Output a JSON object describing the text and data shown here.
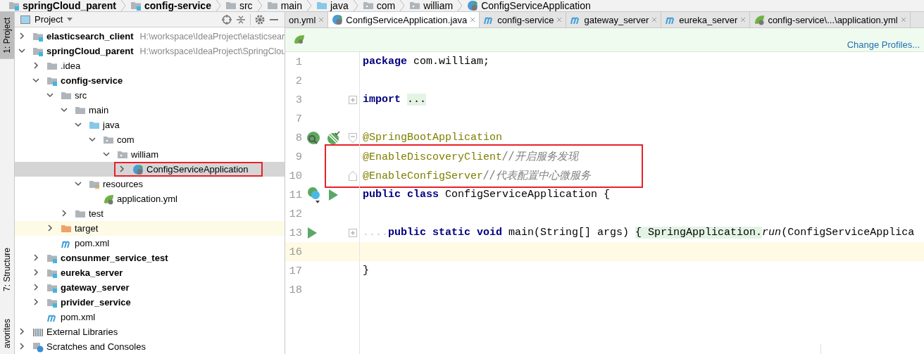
{
  "breadcrumbs": [
    {
      "label": "springCloud_parent",
      "kind": "module"
    },
    {
      "label": "config-service",
      "kind": "module"
    },
    {
      "label": "src",
      "kind": "folder"
    },
    {
      "label": "main",
      "kind": "folder"
    },
    {
      "label": "java",
      "kind": "source"
    },
    {
      "label": "com",
      "kind": "package"
    },
    {
      "label": "william",
      "kind": "package"
    },
    {
      "label": "ConfigServiceApplication",
      "kind": "class"
    }
  ],
  "tool_strip": [
    {
      "label": "1: Project",
      "selected": true
    },
    {
      "label": "7: Structure",
      "selected": false
    },
    {
      "label": "avorites",
      "selected": false
    }
  ],
  "project_panel": {
    "title": "Project",
    "tree": [
      {
        "label": "elasticsearch_client",
        "path": "H:\\workspace\\IdeaProject\\elasticsear",
        "kind": "module",
        "expanded": false,
        "selected": false
      },
      {
        "label": "springCloud_parent",
        "path": "H:\\workspace\\IdeaProject\\SpringClou",
        "kind": "module",
        "expanded": true,
        "selected": false,
        "children": [
          {
            "label": ".idea",
            "kind": "folder",
            "expanded": false,
            "selected": false
          },
          {
            "label": "config-service",
            "kind": "module",
            "expanded": true,
            "selected": false,
            "children": [
              {
                "label": "src",
                "kind": "folder",
                "expanded": true,
                "selected": false,
                "children": [
                  {
                    "label": "main",
                    "kind": "folder",
                    "expanded": true,
                    "selected": false,
                    "children": [
                      {
                        "label": "java",
                        "kind": "source",
                        "expanded": true,
                        "selected": false,
                        "children": [
                          {
                            "label": "com",
                            "kind": "package",
                            "expanded": true,
                            "selected": false,
                            "children": [
                              {
                                "label": "william",
                                "kind": "package",
                                "expanded": true,
                                "selected": false,
                                "children": [
                                  {
                                    "label": "ConfigServiceApplication",
                                    "kind": "class",
                                    "expanded": false,
                                    "selected": true,
                                    "boxed": true
                                  }
                                ]
                              }
                            ]
                          }
                        ]
                      },
                      {
                        "label": "resources",
                        "kind": "resources",
                        "expanded": true,
                        "selected": false,
                        "children": [
                          {
                            "label": "application.yml",
                            "kind": "yml",
                            "selected": false
                          }
                        ]
                      }
                    ]
                  },
                  {
                    "label": "test",
                    "kind": "folder",
                    "expanded": false,
                    "selected": false
                  }
                ]
              },
              {
                "label": "target",
                "kind": "excluded",
                "expanded": false,
                "selected": false
              },
              {
                "label": "pom.xml",
                "kind": "pom",
                "selected": false
              }
            ]
          },
          {
            "label": "consunmer_service_test",
            "kind": "module",
            "expanded": false,
            "selected": false
          },
          {
            "label": "eureka_server",
            "kind": "module",
            "expanded": false,
            "selected": false
          },
          {
            "label": "gateway_server",
            "kind": "module",
            "expanded": false,
            "selected": false
          },
          {
            "label": "privider_service",
            "kind": "module",
            "expanded": false,
            "selected": false
          },
          {
            "label": "pom.xml",
            "kind": "pom",
            "selected": false
          }
        ]
      },
      {
        "label": "External Libraries",
        "kind": "libraries",
        "expanded": false,
        "selected": false
      },
      {
        "label": "Scratches and Consoles",
        "kind": "scratches",
        "expanded": false,
        "selected": false
      }
    ]
  },
  "editor_tabs": [
    {
      "label": "on.yml",
      "kind": "none",
      "selected": false
    },
    {
      "label": "ConfigServiceApplication.java",
      "kind": "class",
      "selected": true
    },
    {
      "label": "config-service",
      "kind": "pom",
      "selected": false
    },
    {
      "label": "gateway_server",
      "kind": "pom",
      "selected": false
    },
    {
      "label": "eureka_server",
      "kind": "pom",
      "selected": false
    },
    {
      "label": "config-service\\...\\application.yml",
      "kind": "yml",
      "selected": false
    }
  ],
  "banner": {
    "link": "Change Profiles..."
  },
  "code": [
    {
      "number": "1",
      "tokens": [
        {
          "text": "package",
          "kind": "keyword"
        },
        {
          "text": " com.william;",
          "kind": "plain"
        }
      ]
    },
    {
      "number": "2"
    },
    {
      "number": "3",
      "fold": {
        "kind": "collapsed"
      },
      "tokens": [
        {
          "text": "import ",
          "kind": "keyword"
        },
        {
          "text": "...",
          "kind": "folded"
        }
      ]
    },
    {
      "number": "7"
    },
    {
      "number": "8",
      "fold": {
        "kind": "start"
      },
      "gutter": [
        {
          "kind": "bean"
        },
        {
          "kind": "leaf"
        }
      ],
      "tokens": [
        {
          "text": "@SpringBootApplication",
          "kind": "annotation"
        }
      ]
    },
    {
      "number": "9",
      "boxed": true,
      "tokens": [
        {
          "text": "@EnableDiscoveryClient",
          "kind": "annotation"
        },
        {
          "text": "//开启服务发现",
          "kind": "comment"
        }
      ]
    },
    {
      "number": "10",
      "boxed": true,
      "fold": {
        "kind": "end"
      },
      "tokens": [
        {
          "text": "@EnableConfigServer",
          "kind": "annotation"
        },
        {
          "text": "//代表配置中心微服务",
          "kind": "comment"
        }
      ]
    },
    {
      "number": "11",
      "gutter": [
        {
          "kind": "class"
        },
        {
          "kind": "run"
        }
      ],
      "tokens": [
        {
          "text": "public class ",
          "kind": "keyword"
        },
        {
          "text": "ConfigServiceApplication {",
          "kind": "plain"
        }
      ]
    },
    {
      "number": "12"
    },
    {
      "number": "13",
      "fold": {
        "kind": "collapsed"
      },
      "gutter": [
        {
          "kind": "run"
        }
      ],
      "tokens": [
        {
          "text": "....",
          "kind": "whitespace"
        },
        {
          "text": "public static void ",
          "kind": "keyword"
        },
        {
          "text": "main(String[] args) ",
          "kind": "plain"
        },
        {
          "text": "{ SpringApplication.",
          "kind": "folded"
        },
        {
          "text": "run",
          "kind": "static"
        },
        {
          "text": "(ConfigServiceApplica",
          "kind": "plain"
        }
      ]
    },
    {
      "number": "16",
      "current": true
    },
    {
      "number": "17",
      "tokens": [
        {
          "text": "}",
          "kind": "plain"
        }
      ]
    },
    {
      "number": "18"
    }
  ]
}
